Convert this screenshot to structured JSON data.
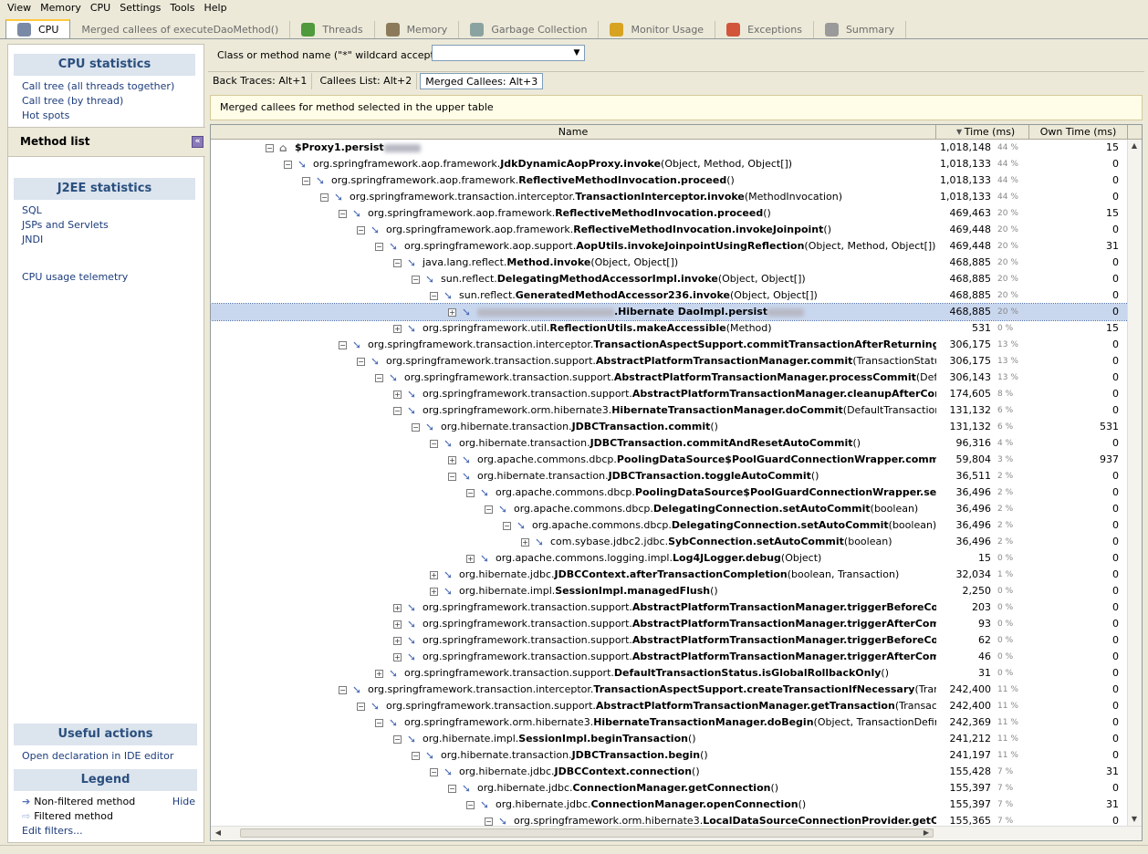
{
  "menu": [
    "View",
    "Memory",
    "CPU",
    "Settings",
    "Tools",
    "Help"
  ],
  "tabs": [
    {
      "label": "CPU",
      "icon": "cpu-icon",
      "color": "#7a8aa6",
      "active": true
    },
    {
      "label": "Merged callees of executeDaoMethod()",
      "icon": "",
      "color": "",
      "active": false
    },
    {
      "label": "Threads",
      "icon": "threads-icon",
      "color": "#4f9a3d",
      "active": false
    },
    {
      "label": "Memory",
      "icon": "memory-icon",
      "color": "#8c7b5a",
      "active": false
    },
    {
      "label": "Garbage Collection",
      "icon": "trash-icon",
      "color": "#8aa3a0",
      "active": false
    },
    {
      "label": "Monitor Usage",
      "icon": "monitor-icon",
      "color": "#d7a321",
      "active": false
    },
    {
      "label": "Exceptions",
      "icon": "exceptions-icon",
      "color": "#d2553b",
      "active": false
    },
    {
      "label": "Summary",
      "icon": "summary-icon",
      "color": "#9a9a9a",
      "active": false
    }
  ],
  "sidebar": {
    "cpu_header": "CPU statistics",
    "cpu_links": [
      "Call tree (all threads together)",
      "Call tree (by thread)",
      "Hot spots"
    ],
    "method_list": "Method list",
    "j2ee_header": "J2EE statistics",
    "j2ee_links": [
      "SQL",
      "JSPs and Servlets",
      "JNDI"
    ],
    "telemetry": "CPU usage telemetry",
    "actions_header": "Useful actions",
    "actions_link": "Open declaration in IDE editor",
    "legend_header": "Legend",
    "legend_nonfiltered": "Non-filtered method",
    "legend_filtered": "Filtered method",
    "legend_hide": "Hide",
    "legend_edit": "Edit filters..."
  },
  "filter": {
    "label": "Class or method name (\"*\" wildcard accepted):",
    "value": ""
  },
  "subtabs": [
    {
      "label": "Back Traces: Alt+1",
      "selected": false
    },
    {
      "label": "Callees List: Alt+2",
      "selected": false
    },
    {
      "label": "Merged Callees: Alt+3",
      "selected": true
    }
  ],
  "info": "Merged callees for method selected in the upper table",
  "table": {
    "headers": {
      "name": "Name",
      "time": "Time (ms)",
      "own": "Own Time (ms)"
    },
    "rows": [
      {
        "d": 0,
        "e": "-",
        "pre": "",
        "b": "$Proxy1.persist",
        "suf": "",
        "blur_after": true,
        "t": "1,018,148",
        "p": "44 %",
        "o": "15",
        "icon": "proxy"
      },
      {
        "d": 1,
        "e": "-",
        "pre": "org.springframework.aop.framework.",
        "b": "JdkDynamicAopProxy.invoke",
        "suf": "(Object, Method, Object[])",
        "t": "1,018,133",
        "p": "44 %",
        "o": "0"
      },
      {
        "d": 2,
        "e": "-",
        "pre": "org.springframework.aop.framework.",
        "b": "ReflectiveMethodInvocation.proceed",
        "suf": "()",
        "t": "1,018,133",
        "p": "44 %",
        "o": "0"
      },
      {
        "d": 3,
        "e": "-",
        "pre": "org.springframework.transaction.interceptor.",
        "b": "TransactionInterceptor.invoke",
        "suf": "(MethodInvocation)",
        "t": "1,018,133",
        "p": "44 %",
        "o": "0"
      },
      {
        "d": 4,
        "e": "-",
        "pre": "org.springframework.aop.framework.",
        "b": "ReflectiveMethodInvocation.proceed",
        "suf": "()",
        "t": "469,463",
        "p": "20 %",
        "o": "15"
      },
      {
        "d": 5,
        "e": "-",
        "pre": "org.springframework.aop.framework.",
        "b": "ReflectiveMethodInvocation.invokeJoinpoint",
        "suf": "()",
        "t": "469,448",
        "p": "20 %",
        "o": "0"
      },
      {
        "d": 6,
        "e": "-",
        "pre": "org.springframework.aop.support.",
        "b": "AopUtils.invokeJoinpointUsingReflection",
        "suf": "(Object, Method, Object[])",
        "t": "469,448",
        "p": "20 %",
        "o": "31"
      },
      {
        "d": 7,
        "e": "-",
        "pre": "java.lang.reflect.",
        "b": "Method.invoke",
        "suf": "(Object, Object[])",
        "t": "468,885",
        "p": "20 %",
        "o": "0"
      },
      {
        "d": 8,
        "e": "-",
        "pre": "sun.reflect.",
        "b": "DelegatingMethodAccessorImpl.invoke",
        "suf": "(Object, Object[])",
        "t": "468,885",
        "p": "20 %",
        "o": "0"
      },
      {
        "d": 9,
        "e": "-",
        "pre": "sun.reflect.",
        "b": "GeneratedMethodAccessor236.invoke",
        "suf": "(Object, Object[])",
        "t": "468,885",
        "p": "20 %",
        "o": "0"
      },
      {
        "d": 10,
        "e": "+",
        "pre": "",
        "b": ".Hibernate DaoImpl.persist",
        "suf": "",
        "blur_before": true,
        "blur_after": true,
        "t": "468,885",
        "p": "20 %",
        "o": "0",
        "sel": true
      },
      {
        "d": 7,
        "e": "+",
        "pre": "org.springframework.util.",
        "b": "ReflectionUtils.makeAccessible",
        "suf": "(Method)",
        "t": "531",
        "p": "0 %",
        "o": "15"
      },
      {
        "d": 4,
        "e": "-",
        "pre": "org.springframework.transaction.interceptor.",
        "b": "TransactionAspectSupport.commitTransactionAfterReturning",
        "suf": "(Transacti",
        "t": "306,175",
        "p": "13 %",
        "o": "0"
      },
      {
        "d": 5,
        "e": "-",
        "pre": "org.springframework.transaction.support.",
        "b": "AbstractPlatformTransactionManager.commit",
        "suf": "(TransactionStatus)",
        "t": "306,175",
        "p": "13 %",
        "o": "0"
      },
      {
        "d": 6,
        "e": "-",
        "pre": "org.springframework.transaction.support.",
        "b": "AbstractPlatformTransactionManager.processCommit",
        "suf": "(DefaultTrans",
        "t": "306,143",
        "p": "13 %",
        "o": "0"
      },
      {
        "d": 7,
        "e": "+",
        "pre": "org.springframework.transaction.support.",
        "b": "AbstractPlatformTransactionManager.cleanupAfterCompletion",
        "suf": "",
        "t": "174,605",
        "p": "8 %",
        "o": "0"
      },
      {
        "d": 7,
        "e": "-",
        "pre": "org.springframework.orm.hibernate3.",
        "b": "HibernateTransactionManager.doCommit",
        "suf": "(DefaultTransactionStatus)",
        "t": "131,132",
        "p": "6 %",
        "o": "0"
      },
      {
        "d": 8,
        "e": "-",
        "pre": "org.hibernate.transaction.",
        "b": "JDBCTransaction.commit",
        "suf": "()",
        "t": "131,132",
        "p": "6 %",
        "o": "531"
      },
      {
        "d": 9,
        "e": "-",
        "pre": "org.hibernate.transaction.",
        "b": "JDBCTransaction.commitAndResetAutoCommit",
        "suf": "()",
        "t": "96,316",
        "p": "4 %",
        "o": "0"
      },
      {
        "d": 10,
        "e": "+",
        "pre": "org.apache.commons.dbcp.",
        "b": "PoolingDataSource$PoolGuardConnectionWrapper.commit",
        "suf": "()",
        "t": "59,804",
        "p": "3 %",
        "o": "937"
      },
      {
        "d": 10,
        "e": "-",
        "pre": "org.hibernate.transaction.",
        "b": "JDBCTransaction.toggleAutoCommit",
        "suf": "()",
        "t": "36,511",
        "p": "2 %",
        "o": "0"
      },
      {
        "d": 11,
        "e": "-",
        "pre": "org.apache.commons.dbcp.",
        "b": "PoolingDataSource$PoolGuardConnectionWrapper.setAutoCo",
        "suf": "",
        "t": "36,496",
        "p": "2 %",
        "o": "0"
      },
      {
        "d": 12,
        "e": "-",
        "pre": "org.apache.commons.dbcp.",
        "b": "DelegatingConnection.setAutoCommit",
        "suf": "(boolean)",
        "t": "36,496",
        "p": "2 %",
        "o": "0"
      },
      {
        "d": 13,
        "e": "-",
        "pre": "org.apache.commons.dbcp.",
        "b": "DelegatingConnection.setAutoCommit",
        "suf": "(boolean)",
        "t": "36,496",
        "p": "2 %",
        "o": "0"
      },
      {
        "d": 14,
        "e": "+",
        "pre": "com.sybase.jdbc2.jdbc.",
        "b": "SybConnection.setAutoCommit",
        "suf": "(boolean)",
        "t": "36,496",
        "p": "2 %",
        "o": "0"
      },
      {
        "d": 11,
        "e": "+",
        "pre": "org.apache.commons.logging.impl.",
        "b": "Log4JLogger.debug",
        "suf": "(Object)",
        "t": "15",
        "p": "0 %",
        "o": "0"
      },
      {
        "d": 9,
        "e": "+",
        "pre": "org.hibernate.jdbc.",
        "b": "JDBCContext.afterTransactionCompletion",
        "suf": "(boolean, Transaction)",
        "t": "32,034",
        "p": "1 %",
        "o": "0"
      },
      {
        "d": 9,
        "e": "+",
        "pre": "org.hibernate.impl.",
        "b": "SessionImpl.managedFlush",
        "suf": "()",
        "t": "2,250",
        "p": "0 %",
        "o": "0"
      },
      {
        "d": 7,
        "e": "+",
        "pre": "org.springframework.transaction.support.",
        "b": "AbstractPlatformTransactionManager.triggerBeforeCommit",
        "suf": "(De",
        "t": "203",
        "p": "0 %",
        "o": "0"
      },
      {
        "d": 7,
        "e": "+",
        "pre": "org.springframework.transaction.support.",
        "b": "AbstractPlatformTransactionManager.triggerAfterCommit",
        "suf": "(Def",
        "t": "93",
        "p": "0 %",
        "o": "0"
      },
      {
        "d": 7,
        "e": "+",
        "pre": "org.springframework.transaction.support.",
        "b": "AbstractPlatformTransactionManager.triggerBeforeCompletio",
        "suf": "",
        "t": "62",
        "p": "0 %",
        "o": "0"
      },
      {
        "d": 7,
        "e": "+",
        "pre": "org.springframework.transaction.support.",
        "b": "AbstractPlatformTransactionManager.triggerAfterCompletion",
        "suf": "",
        "t": "46",
        "p": "0 %",
        "o": "0"
      },
      {
        "d": 6,
        "e": "+",
        "pre": "org.springframework.transaction.support.",
        "b": "DefaultTransactionStatus.isGlobalRollbackOnly",
        "suf": "()",
        "t": "31",
        "p": "0 %",
        "o": "0"
      },
      {
        "d": 4,
        "e": "-",
        "pre": "org.springframework.transaction.interceptor.",
        "b": "TransactionAspectSupport.createTransactionIfNecessary",
        "suf": "(TransactionAt",
        "t": "242,400",
        "p": "11 %",
        "o": "0"
      },
      {
        "d": 5,
        "e": "-",
        "pre": "org.springframework.transaction.support.",
        "b": "AbstractPlatformTransactionManager.getTransaction",
        "suf": "(TransactionDefini",
        "t": "242,400",
        "p": "11 %",
        "o": "0"
      },
      {
        "d": 6,
        "e": "-",
        "pre": "org.springframework.orm.hibernate3.",
        "b": "HibernateTransactionManager.doBegin",
        "suf": "(Object, TransactionDefinition)",
        "t": "242,369",
        "p": "11 %",
        "o": "0"
      },
      {
        "d": 7,
        "e": "-",
        "pre": "org.hibernate.impl.",
        "b": "SessionImpl.beginTransaction",
        "suf": "()",
        "t": "241,212",
        "p": "11 %",
        "o": "0"
      },
      {
        "d": 8,
        "e": "-",
        "pre": "org.hibernate.transaction.",
        "b": "JDBCTransaction.begin",
        "suf": "()",
        "t": "241,197",
        "p": "11 %",
        "o": "0"
      },
      {
        "d": 9,
        "e": "-",
        "pre": "org.hibernate.jdbc.",
        "b": "JDBCContext.connection",
        "suf": "()",
        "t": "155,428",
        "p": "7 %",
        "o": "31"
      },
      {
        "d": 10,
        "e": "-",
        "pre": "org.hibernate.jdbc.",
        "b": "ConnectionManager.getConnection",
        "suf": "()",
        "t": "155,397",
        "p": "7 %",
        "o": "0"
      },
      {
        "d": 11,
        "e": "-",
        "pre": "org.hibernate.jdbc.",
        "b": "ConnectionManager.openConnection",
        "suf": "()",
        "t": "155,397",
        "p": "7 %",
        "o": "31"
      },
      {
        "d": 12,
        "e": "-",
        "pre": "org.springframework.orm.hibernate3.",
        "b": "LocalDataSourceConnectionProvider.getConnect",
        "suf": "",
        "t": "155,365",
        "p": "7 %",
        "o": "0"
      }
    ]
  }
}
